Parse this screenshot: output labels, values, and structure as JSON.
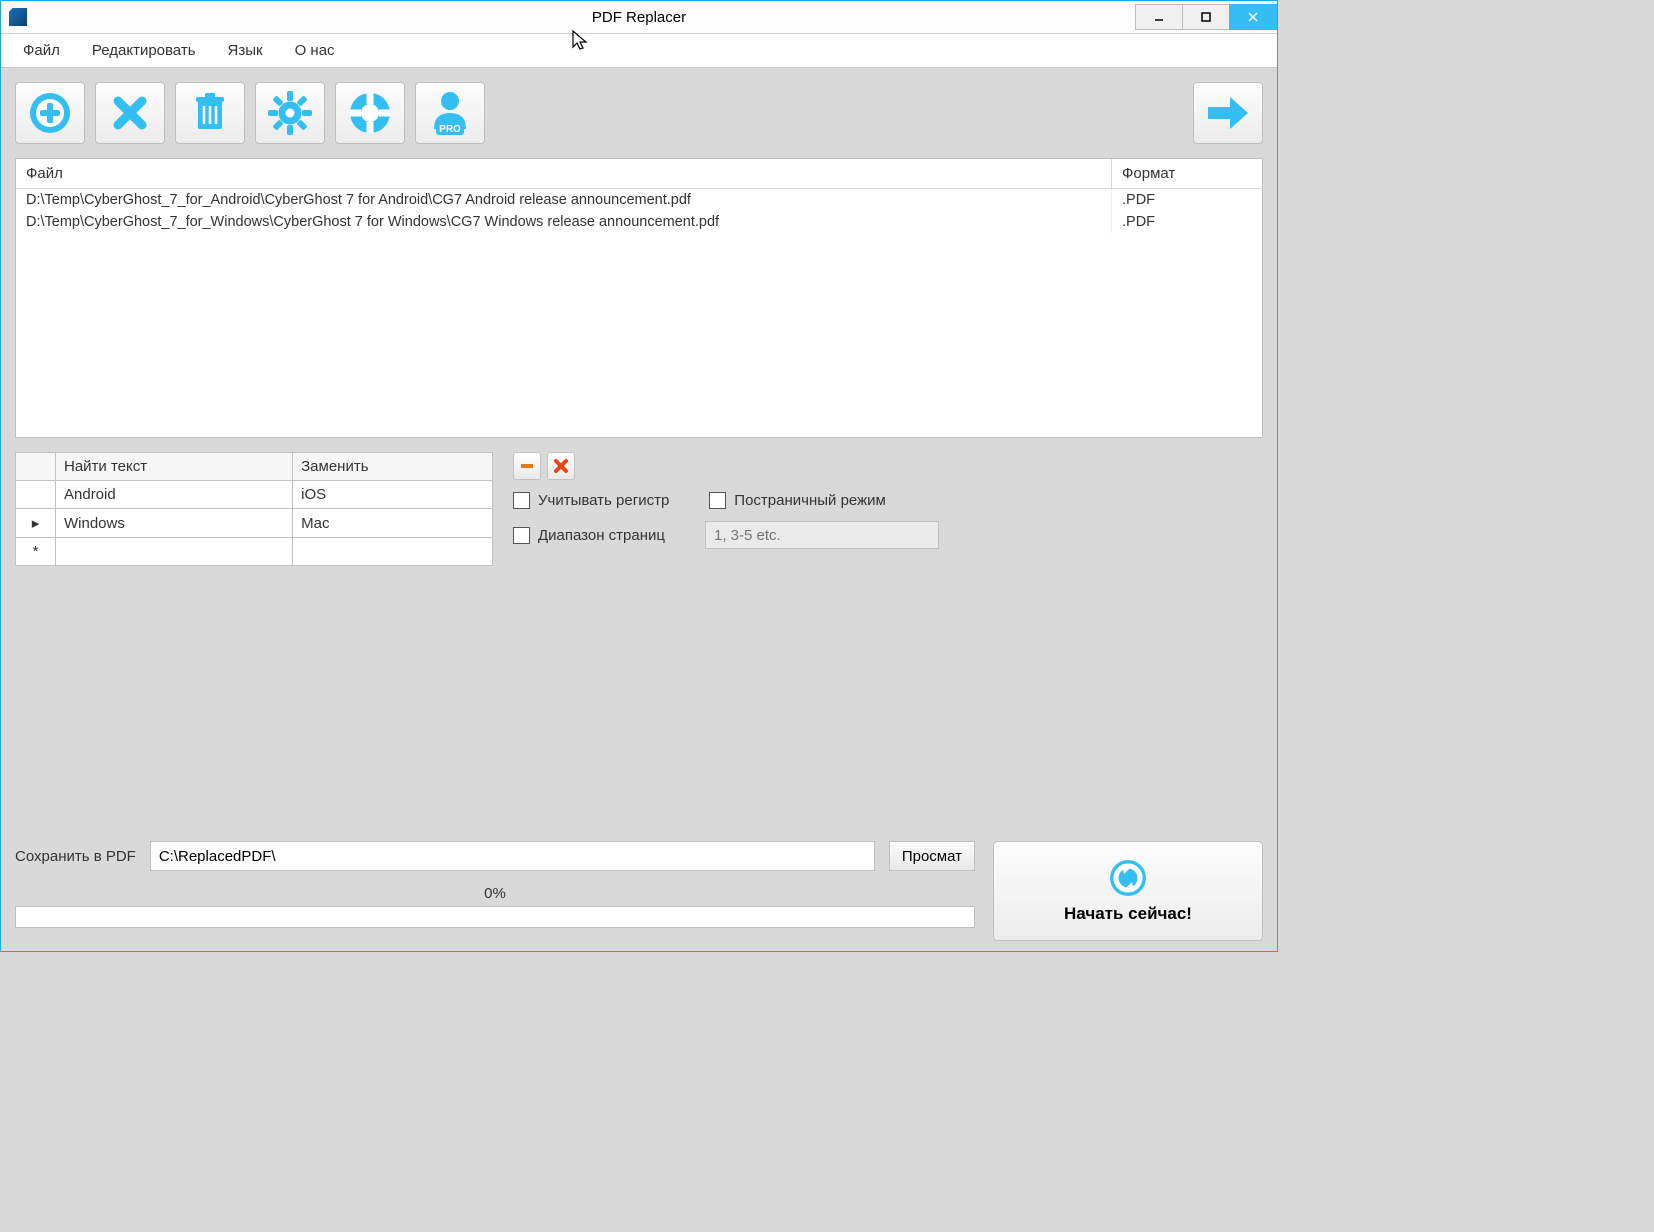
{
  "titlebar": {
    "title": "PDF Replacer"
  },
  "menu": {
    "file": "Файл",
    "edit": "Редактировать",
    "lang": "Язык",
    "about": "О нас"
  },
  "fileTable": {
    "headFile": "Файл",
    "headFmt": "Формат",
    "rows": [
      {
        "path": "D:\\Temp\\CyberGhost_7_for_Android\\CyberGhost 7 for Android\\CG7 Android release announcement.pdf",
        "fmt": ".PDF"
      },
      {
        "path": "D:\\Temp\\CyberGhost_7_for_Windows\\CyberGhost 7 for Windows\\CG7 Windows release announcement.pdf",
        "fmt": ".PDF"
      }
    ]
  },
  "repTable": {
    "headFind": "Найти текст",
    "headReplace": "Заменить",
    "rows": [
      {
        "mk": "",
        "find": "Android",
        "replace": "iOS"
      },
      {
        "mk": "▸",
        "find": "Windows",
        "replace": "Mac"
      },
      {
        "mk": "*",
        "find": "",
        "replace": ""
      }
    ]
  },
  "options": {
    "caseLabel": "Учитывать регистр",
    "pageModeLabel": "Постраничный режим",
    "pageRangeLabel": "Диапазон страниц",
    "pageRangePlaceholder": "1, 3-5 etc."
  },
  "save": {
    "label": "Сохранить в PDF",
    "path": "C:\\ReplacedPDF\\",
    "browse": "Просмат"
  },
  "progress": {
    "percent": "0%"
  },
  "start": {
    "label": "Начать сейчас!"
  },
  "icons": {
    "proBadge": "PRO"
  }
}
